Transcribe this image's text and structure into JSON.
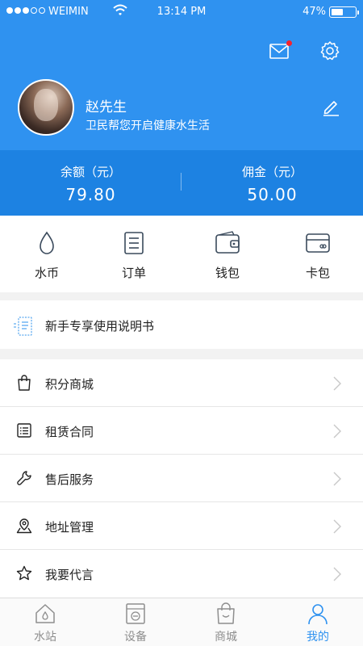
{
  "status_bar": {
    "carrier": "WEIMIN",
    "time": "13:14 PM",
    "battery": "47%"
  },
  "profile": {
    "name": "赵先生",
    "slogan": "卫民帮您开启健康水生活"
  },
  "balance": {
    "left": {
      "label": "余额（元）",
      "value": "79.80"
    },
    "right": {
      "label": "佣金（元）",
      "value": "50.00"
    }
  },
  "quick_actions": [
    {
      "label": "水币",
      "icon": "water-drop-icon"
    },
    {
      "label": "订单",
      "icon": "order-icon"
    },
    {
      "label": "钱包",
      "icon": "wallet-icon"
    },
    {
      "label": "卡包",
      "icon": "card-icon"
    }
  ],
  "guide": {
    "label": "新手专享使用说明书",
    "icon": "manual-icon"
  },
  "menu": [
    {
      "label": "积分商城",
      "icon": "shopping-bag-icon"
    },
    {
      "label": "租赁合同",
      "icon": "contract-icon"
    },
    {
      "label": "售后服务",
      "icon": "wrench-icon"
    },
    {
      "label": "地址管理",
      "icon": "location-icon"
    },
    {
      "label": "我要代言",
      "icon": "star-icon"
    }
  ],
  "tabs": [
    {
      "label": "水站",
      "icon": "home-icon",
      "active": false
    },
    {
      "label": "设备",
      "icon": "device-icon",
      "active": false
    },
    {
      "label": "商城",
      "icon": "store-icon",
      "active": false
    },
    {
      "label": "我的",
      "icon": "person-icon",
      "active": true
    }
  ],
  "colors": {
    "primary": "#2f92f0",
    "primary_dark": "#1d82e2",
    "text": "#222222",
    "inactive": "#8e8e8e",
    "badge": "#f5222d"
  }
}
